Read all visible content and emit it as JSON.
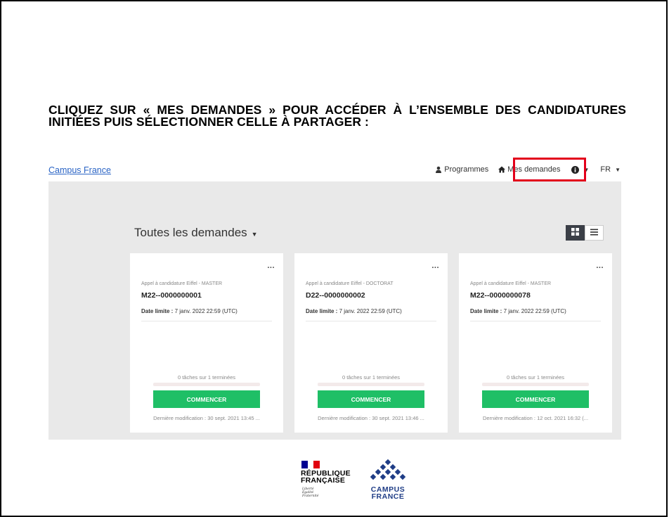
{
  "instruction": "CLIQUEZ SUR « MES DEMANDES » POUR ACCÉDER À L’ENSEMBLE DES CANDIDATURES INITIÉES PUIS SÉLECTIONNER CELLE À PARTAGER :",
  "navbar": {
    "brand": "Campus France",
    "programmes_label": "Programmes",
    "mes_demandes_label": "Mes demandes",
    "info_icon": "info-icon",
    "language": "FR"
  },
  "main": {
    "heading": "Toutes les demandes",
    "view_toggle": [
      "grid-view",
      "list-view"
    ]
  },
  "cards": [
    {
      "menu": "...",
      "programme": "Appel à candidature Eiffel - MASTER",
      "reference": "M22--0000000001",
      "date_label": "Date limite :",
      "date_value": "7 janv. 2022 22:59 (UTC)",
      "tasks": "0 tâches sur 1 terminées",
      "progress": 0,
      "button": "COMMENCER",
      "modified": "Dernière modification : 30 sept. 2021 13:45 ..."
    },
    {
      "menu": "...",
      "programme": "Appel à candidature Eiffel - DOCTORAT",
      "reference": "D22--0000000002",
      "date_label": "Date limite :",
      "date_value": "7 janv. 2022 22:59 (UTC)",
      "tasks": "0 tâches sur 1 terminées",
      "progress": 0,
      "button": "COMMENCER",
      "modified": "Dernière modification : 30 sept. 2021 13:46 ..."
    },
    {
      "menu": "...",
      "programme": "Appel à candidature Eiffel - MASTER",
      "reference": "M22--0000000078",
      "date_label": "Date limite :",
      "date_value": "7 janv. 2022 22:59 (UTC)",
      "tasks": "0 tâches sur 1 terminées",
      "progress": 0,
      "button": "COMMENCER",
      "modified": "Dernière modification : 12 oct. 2021 16:32 (..."
    }
  ],
  "footer": {
    "rf_title": [
      "RÉPUBLIQUE",
      "FRANÇAISE"
    ],
    "rf_motto": [
      "Liberté",
      "Égalité",
      "Fraternité"
    ],
    "cf_title": [
      "CAMPUS",
      "FRANCE"
    ]
  },
  "colors": {
    "highlight": "#e3001b",
    "button": "#1fbf66",
    "content_bg": "#e9e9e9",
    "brand_link": "#2a64c5",
    "campus_blue": "#1f3d86"
  }
}
